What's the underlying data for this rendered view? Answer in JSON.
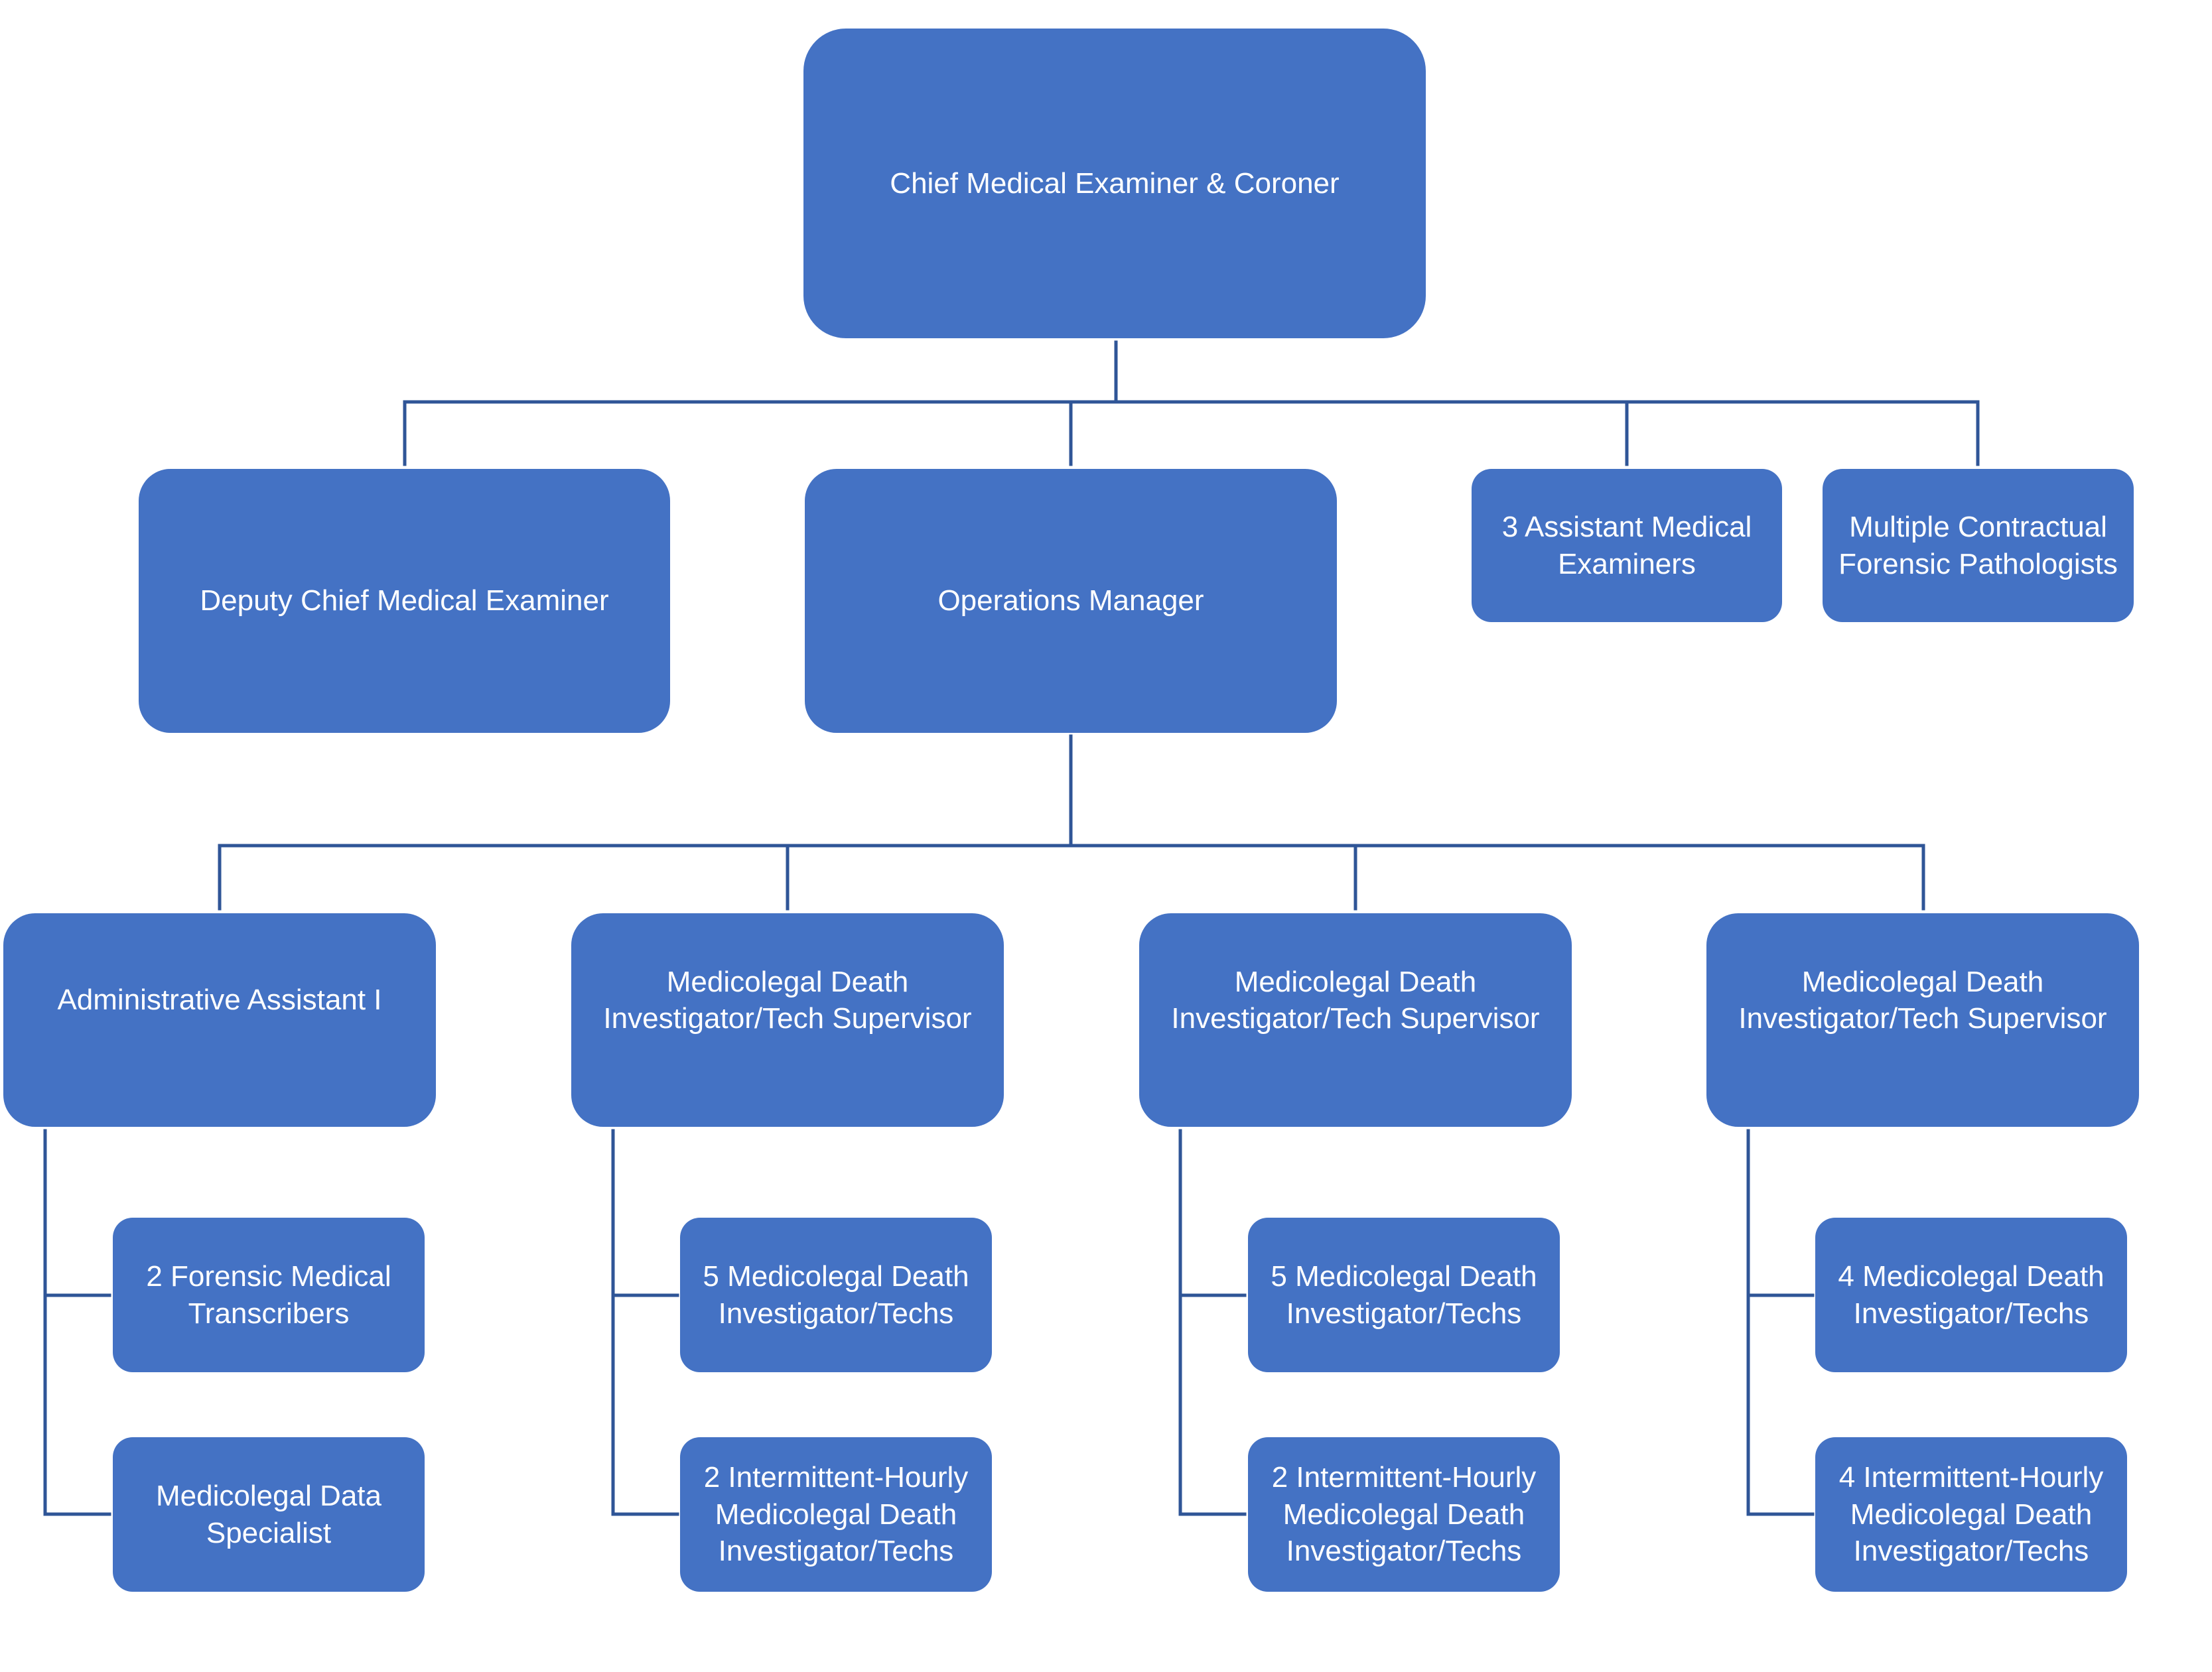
{
  "chart_data": {
    "type": "org-chart",
    "title": "",
    "colors": {
      "node_fill": "#4472C4",
      "node_text": "#FFFFFF",
      "connector": "#2F5597"
    },
    "nodes": [
      {
        "id": "chief",
        "label": "Chief Medical Examiner & Coroner",
        "parent": null
      },
      {
        "id": "deputy",
        "label": "Deputy Chief Medical Examiner",
        "parent": "chief"
      },
      {
        "id": "ops",
        "label": "Operations Manager",
        "parent": "chief"
      },
      {
        "id": "asst_me",
        "label": "3 Assistant Medical\nExaminers",
        "parent": "chief"
      },
      {
        "id": "contract",
        "label": "Multiple Contractual\nForensic Pathologists",
        "parent": "chief"
      },
      {
        "id": "admin",
        "label": "Administrative Assistant I",
        "parent": "ops"
      },
      {
        "id": "sup1",
        "label": "Medicolegal Death\nInvestigator/Tech Supervisor",
        "parent": "ops"
      },
      {
        "id": "sup2",
        "label": "Medicolegal Death\nInvestigator/Tech Supervisor",
        "parent": "ops"
      },
      {
        "id": "sup3",
        "label": "Medicolegal Death\nInvestigator/Tech Supervisor",
        "parent": "ops"
      },
      {
        "id": "transcribers",
        "label": "2 Forensic Medical\nTranscribers",
        "parent": "admin"
      },
      {
        "id": "data_spec",
        "label": "Medicolegal Data\nSpecialist",
        "parent": "admin"
      },
      {
        "id": "techs1",
        "label": "5 Medicolegal Death\nInvestigator/Techs",
        "parent": "sup1"
      },
      {
        "id": "hourly1",
        "label": "2 Intermittent-Hourly\nMedicolegal Death\nInvestigator/Techs",
        "parent": "sup1"
      },
      {
        "id": "techs2",
        "label": "5 Medicolegal Death\nInvestigator/Techs",
        "parent": "sup2"
      },
      {
        "id": "hourly2",
        "label": "2 Intermittent-Hourly\nMedicolegal Death\nInvestigator/Techs",
        "parent": "sup2"
      },
      {
        "id": "techs3",
        "label": "4 Medicolegal Death\nInvestigator/Techs",
        "parent": "sup3"
      },
      {
        "id": "hourly3",
        "label": "4 Intermittent-Hourly\nMedicolegal Death\nInvestigator/Techs",
        "parent": "sup3"
      }
    ]
  }
}
